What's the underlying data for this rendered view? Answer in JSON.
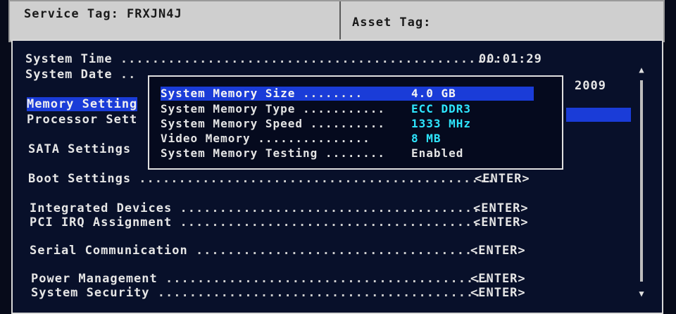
{
  "header": {
    "service_tag_label": "Service Tag: FRXJN4J",
    "asset_tag_label": "Asset Tag:"
  },
  "menu": {
    "system_time": {
      "label": "System Time",
      "dots": " ................................................",
      "value": "00:01:29"
    },
    "system_date": {
      "label": "System Date",
      "dots": " ..",
      "value": "2009"
    },
    "memory_settings": {
      "label": "Memory Setting"
    },
    "processor_settings": {
      "label": "Processor Sett"
    },
    "sata_settings": {
      "label": "SATA Settings"
    },
    "boot_settings": {
      "label": "Boot Settings",
      "dots": " .............................................",
      "value": "<ENTER>"
    },
    "integrated_devices": {
      "label": "Integrated Devices",
      "dots": " ......................................",
      "value": "<ENTER>"
    },
    "pci_irq": {
      "label": "PCI IRQ Assignment",
      "dots": " ......................................",
      "value": "<ENTER>"
    },
    "serial_comm": {
      "label": "Serial Communication",
      "dots": " ....................................",
      "value": "<ENTER>"
    },
    "power_mgmt": {
      "label": "Power Management",
      "dots": " .........................................",
      "value": "<ENTER>"
    },
    "system_security": {
      "label": "System Security",
      "dots": " .........................................",
      "value": "<ENTER>"
    }
  },
  "popup": {
    "rows": [
      {
        "label": "System Memory Size",
        "dots": " ........",
        "value": "4.0 GB"
      },
      {
        "label": "System Memory Type",
        "dots": " ...........",
        "value": "ECC DDR3"
      },
      {
        "label": "System Memory Speed",
        "dots": " ..........",
        "value": "1333 MHz"
      },
      {
        "label": "Video Memory",
        "dots": " ...............",
        "value": "8 MB"
      },
      {
        "label": "System Memory Testing",
        "dots": " ........",
        "value": "Enabled"
      }
    ]
  },
  "scrollbar": {
    "up_arrow": "▲",
    "down_arrow": "▼"
  },
  "colors": {
    "background": "#070b1a",
    "highlight": "#1a3cd8",
    "value_cyan": "#2ee6ff",
    "header_bg": "#cfcfcf"
  }
}
